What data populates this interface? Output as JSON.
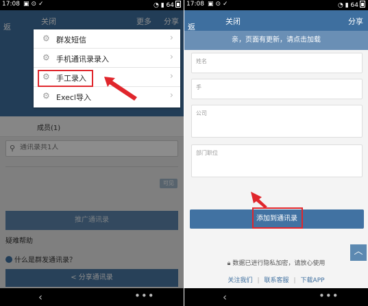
{
  "status": {
    "time": "17:08",
    "battery": "64"
  },
  "left": {
    "title": {
      "back": "返回",
      "close": "关闭",
      "more": "更多",
      "share": "分享"
    },
    "menu": [
      {
        "label": "群发短信"
      },
      {
        "label": "手机通讯录录入"
      },
      {
        "label": "手工录入"
      },
      {
        "label": "Execl导入"
      }
    ],
    "tab_members": "成员(1)",
    "search_placeholder": "通讯录共1人",
    "ok_badge": "可见",
    "promote_button": "推广通讯录",
    "help_title": "疑难帮助",
    "faq_item": "什么是群发通讯录？",
    "share_bar": "分享通讯录"
  },
  "right": {
    "title": {
      "back": "返回",
      "close": "关闭",
      "share": "分享"
    },
    "banner": "亲，页面有更新，请点击加载",
    "fields": {
      "name": "姓名",
      "phone": "手",
      "company": "公司",
      "department": "部门职位"
    },
    "add_button": "添加到通讯录",
    "privacy": "数据已进行隐私加密，请放心使用",
    "links": [
      "关注我们",
      "联系客服",
      "下载APP"
    ]
  },
  "colors": {
    "header_blue": "#3e6f9f",
    "highlight_red": "#e0262c"
  }
}
